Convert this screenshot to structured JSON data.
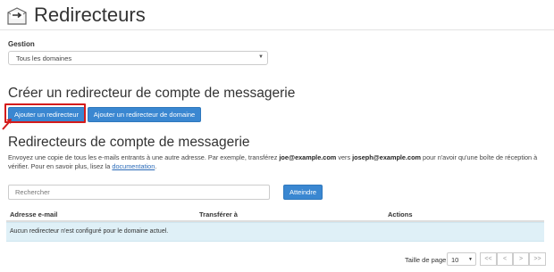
{
  "header": {
    "title": "Redirecteurs",
    "icon": "forward-arrow-icon"
  },
  "gestion": {
    "label": "Gestion",
    "selected": "Tous les domaines"
  },
  "create_section": {
    "title": "Créer un redirecteur de compte de messagerie",
    "add_button": "Ajouter un redirecteur",
    "add_domain_button": "Ajouter un redirecteur de domaine"
  },
  "list_section": {
    "title": "Redirecteurs de compte de messagerie",
    "desc_part1": "Envoyez une copie de tous les e-mails entrants à une autre adresse. Par exemple, transférez ",
    "desc_bold1": "joe@example.com",
    "desc_part2": " vers ",
    "desc_bold2": "joseph@example.com",
    "desc_part3": " pour n'avoir qu'une boîte de réception à vérifier. Pour en savoir plus, lisez la ",
    "desc_link": "documentation",
    "desc_part4": "."
  },
  "search": {
    "placeholder": "Rechercher",
    "go_button": "Atteindre"
  },
  "table": {
    "columns": [
      "Adresse e-mail",
      "Transférer à",
      "Actions"
    ],
    "empty_message": "Aucun redirecteur n'est configuré pour le domaine actuel."
  },
  "pagination": {
    "page_size_label": "Taille de page",
    "page_size": "10",
    "buttons": [
      "<<",
      "<",
      ">",
      ">>"
    ]
  },
  "colors": {
    "primary_button": "#3a87d1",
    "highlight": "#d41b1b",
    "empty_row": "#dff0f7"
  }
}
